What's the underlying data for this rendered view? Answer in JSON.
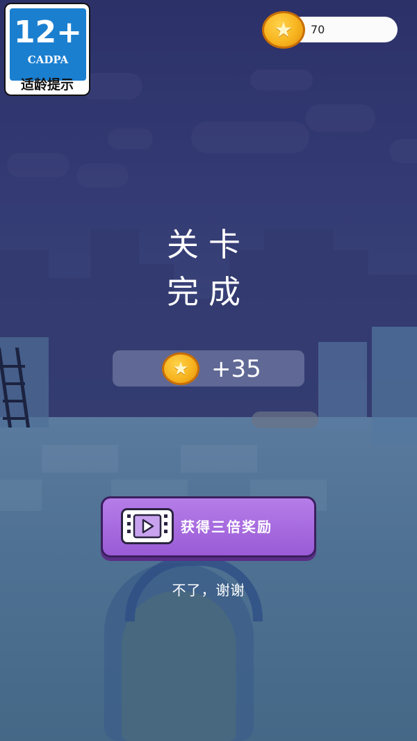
{
  "age_rating": {
    "number": "12+",
    "org": "CADPA",
    "hint": "适龄提示"
  },
  "currency": {
    "balance": "70",
    "icon": "star-coin-icon"
  },
  "result": {
    "title_line1": "关卡",
    "title_line2": "完成"
  },
  "reward": {
    "amount": "+35",
    "icon": "star-coin-icon"
  },
  "triple_button": {
    "label": "获得三倍奖励",
    "icon": "video-play-icon",
    "color": "#9d5fd9"
  },
  "decline_link": {
    "label": "不了，谢谢"
  }
}
